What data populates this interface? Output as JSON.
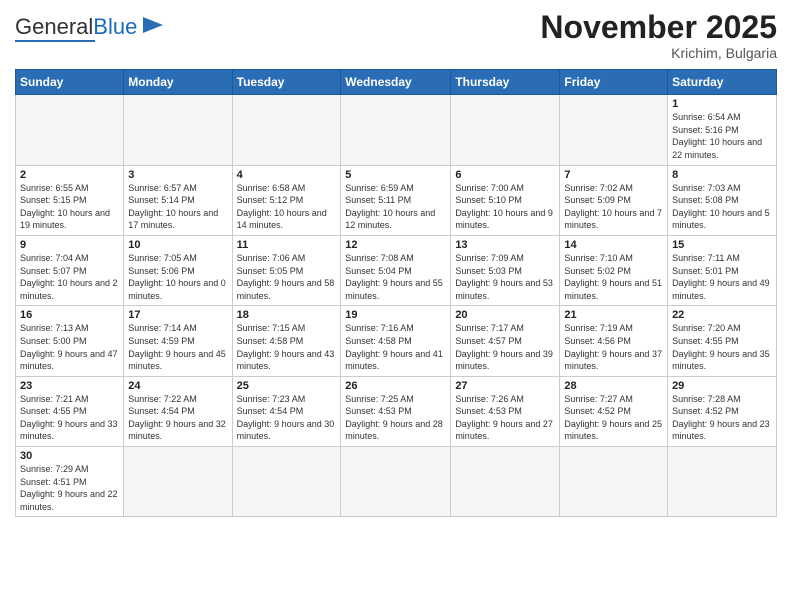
{
  "logo": {
    "text_general": "General",
    "text_blue": "Blue"
  },
  "title": "November 2025",
  "location": "Krichim, Bulgaria",
  "weekdays": [
    "Sunday",
    "Monday",
    "Tuesday",
    "Wednesday",
    "Thursday",
    "Friday",
    "Saturday"
  ],
  "weeks": [
    [
      {
        "day": "",
        "info": ""
      },
      {
        "day": "",
        "info": ""
      },
      {
        "day": "",
        "info": ""
      },
      {
        "day": "",
        "info": ""
      },
      {
        "day": "",
        "info": ""
      },
      {
        "day": "",
        "info": ""
      },
      {
        "day": "1",
        "info": "Sunrise: 6:54 AM\nSunset: 5:16 PM\nDaylight: 10 hours and 22 minutes."
      }
    ],
    [
      {
        "day": "2",
        "info": "Sunrise: 6:55 AM\nSunset: 5:15 PM\nDaylight: 10 hours and 19 minutes."
      },
      {
        "day": "3",
        "info": "Sunrise: 6:57 AM\nSunset: 5:14 PM\nDaylight: 10 hours and 17 minutes."
      },
      {
        "day": "4",
        "info": "Sunrise: 6:58 AM\nSunset: 5:12 PM\nDaylight: 10 hours and 14 minutes."
      },
      {
        "day": "5",
        "info": "Sunrise: 6:59 AM\nSunset: 5:11 PM\nDaylight: 10 hours and 12 minutes."
      },
      {
        "day": "6",
        "info": "Sunrise: 7:00 AM\nSunset: 5:10 PM\nDaylight: 10 hours and 9 minutes."
      },
      {
        "day": "7",
        "info": "Sunrise: 7:02 AM\nSunset: 5:09 PM\nDaylight: 10 hours and 7 minutes."
      },
      {
        "day": "8",
        "info": "Sunrise: 7:03 AM\nSunset: 5:08 PM\nDaylight: 10 hours and 5 minutes."
      }
    ],
    [
      {
        "day": "9",
        "info": "Sunrise: 7:04 AM\nSunset: 5:07 PM\nDaylight: 10 hours and 2 minutes."
      },
      {
        "day": "10",
        "info": "Sunrise: 7:05 AM\nSunset: 5:06 PM\nDaylight: 10 hours and 0 minutes."
      },
      {
        "day": "11",
        "info": "Sunrise: 7:06 AM\nSunset: 5:05 PM\nDaylight: 9 hours and 58 minutes."
      },
      {
        "day": "12",
        "info": "Sunrise: 7:08 AM\nSunset: 5:04 PM\nDaylight: 9 hours and 55 minutes."
      },
      {
        "day": "13",
        "info": "Sunrise: 7:09 AM\nSunset: 5:03 PM\nDaylight: 9 hours and 53 minutes."
      },
      {
        "day": "14",
        "info": "Sunrise: 7:10 AM\nSunset: 5:02 PM\nDaylight: 9 hours and 51 minutes."
      },
      {
        "day": "15",
        "info": "Sunrise: 7:11 AM\nSunset: 5:01 PM\nDaylight: 9 hours and 49 minutes."
      }
    ],
    [
      {
        "day": "16",
        "info": "Sunrise: 7:13 AM\nSunset: 5:00 PM\nDaylight: 9 hours and 47 minutes."
      },
      {
        "day": "17",
        "info": "Sunrise: 7:14 AM\nSunset: 4:59 PM\nDaylight: 9 hours and 45 minutes."
      },
      {
        "day": "18",
        "info": "Sunrise: 7:15 AM\nSunset: 4:58 PM\nDaylight: 9 hours and 43 minutes."
      },
      {
        "day": "19",
        "info": "Sunrise: 7:16 AM\nSunset: 4:58 PM\nDaylight: 9 hours and 41 minutes."
      },
      {
        "day": "20",
        "info": "Sunrise: 7:17 AM\nSunset: 4:57 PM\nDaylight: 9 hours and 39 minutes."
      },
      {
        "day": "21",
        "info": "Sunrise: 7:19 AM\nSunset: 4:56 PM\nDaylight: 9 hours and 37 minutes."
      },
      {
        "day": "22",
        "info": "Sunrise: 7:20 AM\nSunset: 4:55 PM\nDaylight: 9 hours and 35 minutes."
      }
    ],
    [
      {
        "day": "23",
        "info": "Sunrise: 7:21 AM\nSunset: 4:55 PM\nDaylight: 9 hours and 33 minutes."
      },
      {
        "day": "24",
        "info": "Sunrise: 7:22 AM\nSunset: 4:54 PM\nDaylight: 9 hours and 32 minutes."
      },
      {
        "day": "25",
        "info": "Sunrise: 7:23 AM\nSunset: 4:54 PM\nDaylight: 9 hours and 30 minutes."
      },
      {
        "day": "26",
        "info": "Sunrise: 7:25 AM\nSunset: 4:53 PM\nDaylight: 9 hours and 28 minutes."
      },
      {
        "day": "27",
        "info": "Sunrise: 7:26 AM\nSunset: 4:53 PM\nDaylight: 9 hours and 27 minutes."
      },
      {
        "day": "28",
        "info": "Sunrise: 7:27 AM\nSunset: 4:52 PM\nDaylight: 9 hours and 25 minutes."
      },
      {
        "day": "29",
        "info": "Sunrise: 7:28 AM\nSunset: 4:52 PM\nDaylight: 9 hours and 23 minutes."
      }
    ],
    [
      {
        "day": "30",
        "info": "Sunrise: 7:29 AM\nSunset: 4:51 PM\nDaylight: 9 hours and 22 minutes."
      },
      {
        "day": "",
        "info": ""
      },
      {
        "day": "",
        "info": ""
      },
      {
        "day": "",
        "info": ""
      },
      {
        "day": "",
        "info": ""
      },
      {
        "day": "",
        "info": ""
      },
      {
        "day": "",
        "info": ""
      }
    ]
  ]
}
